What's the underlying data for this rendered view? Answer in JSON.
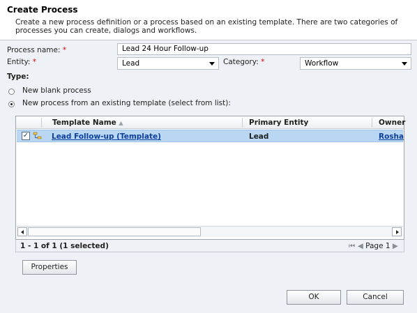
{
  "dialog": {
    "title": "Create Process",
    "description": "Create a new process definition or a process based on an existing template. There are two categories of processes you can create, dialogs and workflows."
  },
  "form": {
    "process_name_label": "Process name:",
    "process_name_value": "Lead 24 Hour Follow-up",
    "entity_label": "Entity:",
    "entity_value": "Lead",
    "category_label": "Category:",
    "category_value": "Workflow",
    "required_marker": "*",
    "type_label": "Type:",
    "radio_blank": "New blank process",
    "radio_template": "New process from an existing template (select from list):",
    "selected_type": "template"
  },
  "grid": {
    "columns": [
      "Template Name",
      "Primary Entity",
      "Owner"
    ],
    "sort_indicator": "▲",
    "rows": [
      {
        "template_name": "Lead Follow-up (Template)",
        "primary_entity": "Lead",
        "owner": "Rosha",
        "checked": true,
        "selected": true
      }
    ],
    "status": "1 - 1 of 1 (1 selected)",
    "pager_first": "⏮",
    "pager_prev": "◀",
    "page_label": "Page 1",
    "pager_next": "▶",
    "check_mark": "✓"
  },
  "buttons": {
    "properties": "Properties",
    "ok": "OK",
    "cancel": "Cancel"
  },
  "icons": {
    "row_icon": "process-template-icon",
    "dropdown": "chevron-down-icon"
  },
  "colors": {
    "selection": "#b9d7f3",
    "link": "#0c3e9b",
    "required": "#e00000"
  }
}
